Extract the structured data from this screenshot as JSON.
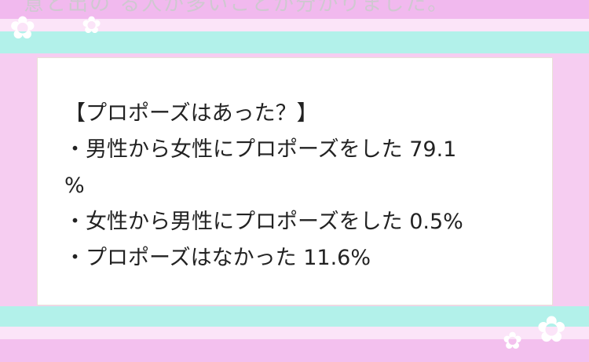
{
  "header": {
    "partial_text": "意と出の る人が多いことが分かりました。"
  },
  "article": {
    "heading": "【プロポーズはあった？】",
    "lines": [
      "・男性から女性にプロポーズをした 79.1",
      "%",
      "・女性から男性にプロポーズをした 0.5%",
      "・プロポーズはなかった 11.6%"
    ]
  },
  "decor": {
    "star_icon": "✿",
    "colors": {
      "pink": "#f1b9ee",
      "mint": "#b2f1ea",
      "card": "#ffffff",
      "text": "#222222"
    }
  }
}
